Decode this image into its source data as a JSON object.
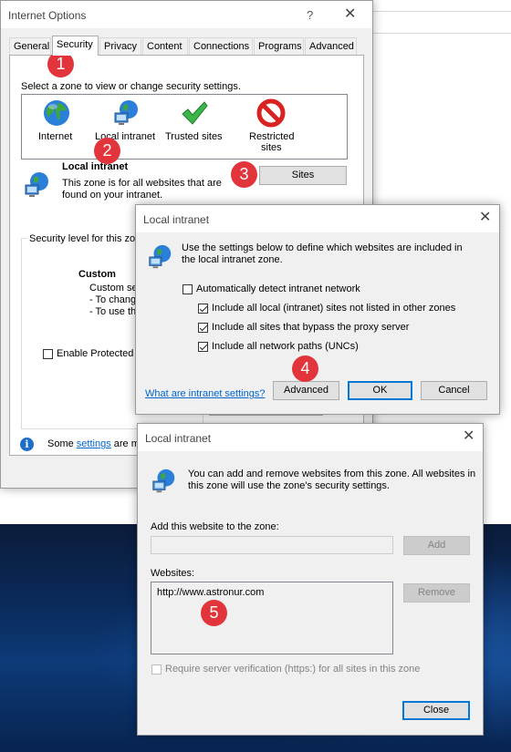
{
  "internet_options": {
    "title": "Internet Options",
    "help": "?",
    "close": "✕",
    "tabs": [
      "General",
      "Security",
      "Privacy",
      "Content",
      "Connections",
      "Programs",
      "Advanced"
    ],
    "zone_prompt": "Select a zone to view or change security settings.",
    "zones": [
      "Internet",
      "Local intranet",
      "Trusted sites",
      "Restricted sites"
    ],
    "restricted_line1": "Restricted",
    "restricted_line2": "sites",
    "zone_heading": "Local intranet",
    "zone_desc_1": "This zone is for all websites that are",
    "zone_desc_2": "found on your intranet.",
    "sites_button": "Sites",
    "security_level_group": "Security level for this zo",
    "custom_label": "Custom",
    "custom_line1": "Custom se",
    "custom_line2": "- To chang",
    "custom_line3": "- To use th",
    "protected_mode": "Enable Protected M",
    "info_prefix": "Some ",
    "info_link": "settings",
    "info_suffix": " are ma"
  },
  "intranet_dialog": {
    "title": "Local intranet",
    "close": "✕",
    "desc_1": "Use the settings below to define which websites are included in",
    "desc_2": "the local intranet zone.",
    "auto_detect": "Automatically detect intranet network",
    "opt_local": "Include all local (intranet) sites not listed in other zones",
    "opt_proxy": "Include all sites that bypass the proxy server",
    "opt_unc": "Include all network paths (UNCs)",
    "help_link": "What are intranet settings?",
    "advanced": "Advanced",
    "ok": "OK",
    "cancel": "Cancel"
  },
  "sites_dialog": {
    "title": "Local intranet",
    "close": "✕",
    "desc_1": "You can add and remove websites from this zone. All websites in",
    "desc_2": "this zone will use the zone's security settings.",
    "add_label": "Add this website to the zone:",
    "add_value": "",
    "add_button": "Add",
    "websites_label": "Websites:",
    "websites": [
      "http://www.astronur.com"
    ],
    "remove_button": "Remove",
    "require_https": "Require server verification (https:) for all sites in this zone",
    "close_button": "Close"
  },
  "callouts": [
    "1",
    "2",
    "3",
    "4",
    "5"
  ],
  "colors": {
    "callout": "#e2343b",
    "accent": "#0078d7",
    "link": "#0066cc"
  }
}
